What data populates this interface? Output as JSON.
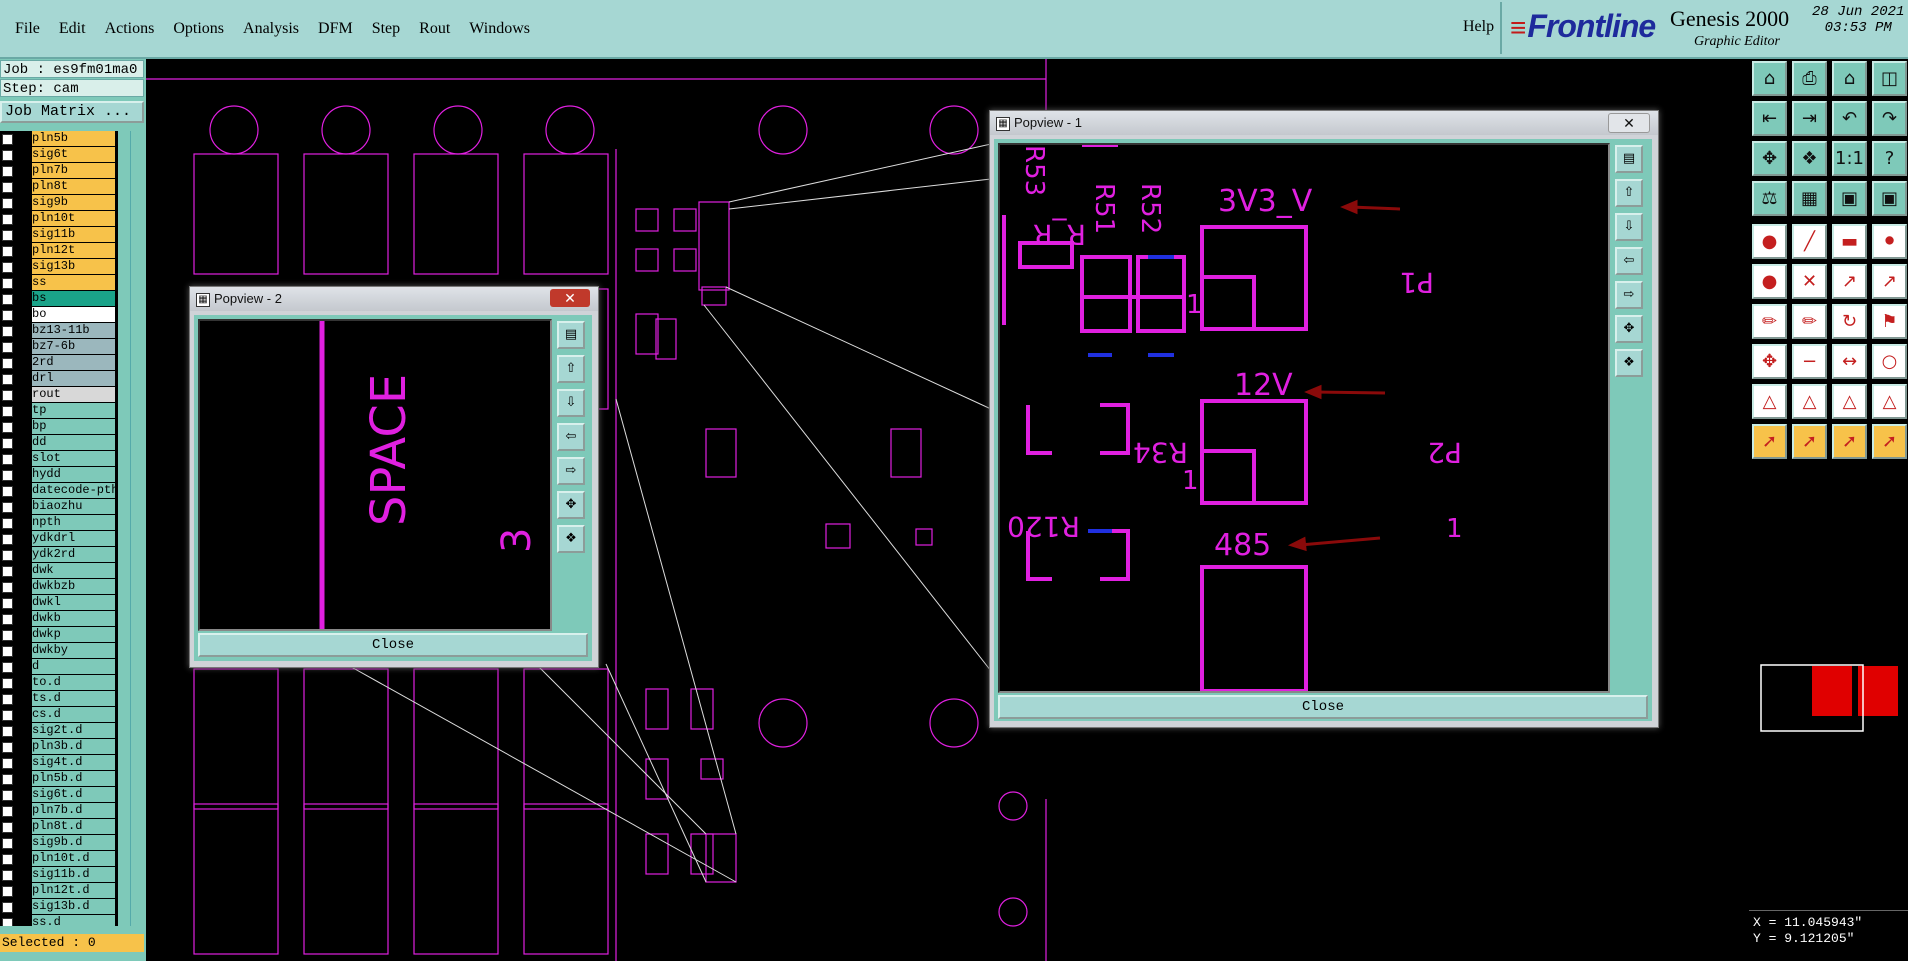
{
  "menu": {
    "items": [
      "File",
      "Edit",
      "Actions",
      "Options",
      "Analysis",
      "DFM",
      "Step",
      "Rout",
      "Windows"
    ],
    "help": "Help"
  },
  "brand": {
    "logo": "Frontline",
    "product": "Genesis 2000",
    "subtitle": "Graphic Editor",
    "date": "28 Jun 2021",
    "time": "03:53 PM"
  },
  "job": {
    "label": "Job : es9fm01ma0",
    "step": "Step: cam",
    "matrix_button": "Job Matrix ..."
  },
  "layers": [
    {
      "name": "pln5b",
      "color": "#f7c24a"
    },
    {
      "name": "sig6t",
      "color": "#f7c24a"
    },
    {
      "name": "pln7b",
      "color": "#f7c24a"
    },
    {
      "name": "pln8t",
      "color": "#f7c24a"
    },
    {
      "name": "sig9b",
      "color": "#f7c24a"
    },
    {
      "name": "pln10t",
      "color": "#f7c24a"
    },
    {
      "name": "sig11b",
      "color": "#f7c24a"
    },
    {
      "name": "pln12t",
      "color": "#f7c24a"
    },
    {
      "name": "sig13b",
      "color": "#f7c24a"
    },
    {
      "name": "ss",
      "color": "#f7c24a"
    },
    {
      "name": "bs",
      "color": "#1aa389"
    },
    {
      "name": "bo",
      "color": "#ffffff"
    },
    {
      "name": "bz13-11b",
      "color": "#9bb7bd"
    },
    {
      "name": "bz7-6b",
      "color": "#9bb7bd"
    },
    {
      "name": "2rd",
      "color": "#9bb7bd"
    },
    {
      "name": "drl",
      "color": "#9bb7bd"
    },
    {
      "name": "rout",
      "color": "#d8d8d8"
    },
    {
      "name": "tp",
      "color": "#7ec9b9"
    },
    {
      "name": "bp",
      "color": "#7ec9b9"
    },
    {
      "name": "dd",
      "color": "#7ec9b9"
    },
    {
      "name": "slot",
      "color": "#7ec9b9"
    },
    {
      "name": "hydd",
      "color": "#7ec9b9"
    },
    {
      "name": "datecode-pth",
      "color": "#7ec9b9"
    },
    {
      "name": "biaozhu",
      "color": "#7ec9b9"
    },
    {
      "name": "npth",
      "color": "#7ec9b9"
    },
    {
      "name": "ydkdrl",
      "color": "#7ec9b9"
    },
    {
      "name": "ydk2rd",
      "color": "#7ec9b9"
    },
    {
      "name": "dwk",
      "color": "#7ec9b9"
    },
    {
      "name": "dwkbzb",
      "color": "#7ec9b9"
    },
    {
      "name": "dwkl",
      "color": "#7ec9b9"
    },
    {
      "name": "dwkb",
      "color": "#7ec9b9"
    },
    {
      "name": "dwkp",
      "color": "#7ec9b9"
    },
    {
      "name": "dwkby",
      "color": "#7ec9b9"
    },
    {
      "name": "d",
      "color": "#7ec9b9"
    },
    {
      "name": "to.d",
      "color": "#7ec9b9"
    },
    {
      "name": "ts.d",
      "color": "#7ec9b9"
    },
    {
      "name": "cs.d",
      "color": "#7ec9b9"
    },
    {
      "name": "sig2t.d",
      "color": "#7ec9b9"
    },
    {
      "name": "pln3b.d",
      "color": "#7ec9b9"
    },
    {
      "name": "sig4t.d",
      "color": "#7ec9b9"
    },
    {
      "name": "pln5b.d",
      "color": "#7ec9b9"
    },
    {
      "name": "sig6t.d",
      "color": "#7ec9b9"
    },
    {
      "name": "pln7b.d",
      "color": "#7ec9b9"
    },
    {
      "name": "pln8t.d",
      "color": "#7ec9b9"
    },
    {
      "name": "sig9b.d",
      "color": "#7ec9b9"
    },
    {
      "name": "pln10t.d",
      "color": "#7ec9b9"
    },
    {
      "name": "sig11b.d",
      "color": "#7ec9b9"
    },
    {
      "name": "pln12t.d",
      "color": "#7ec9b9"
    },
    {
      "name": "sig13b.d",
      "color": "#7ec9b9"
    },
    {
      "name": "ss.d",
      "color": "#7ec9b9"
    }
  ],
  "status": {
    "selected": "Selected : 0"
  },
  "coords": {
    "x": "X = 11.045943\"",
    "y": "Y = 9.121205\""
  },
  "popview1": {
    "title": "Popview - 1",
    "close": "Close",
    "labels": {
      "v33": "3V3_V",
      "v12": "12V",
      "v485": "485",
      "p1": "P1",
      "p2": "P2",
      "r34": "R34",
      "r120": "R120",
      "r51": "R51",
      "r52": "R52",
      "r53": "R53",
      "one": "1",
      "rr": "R_R"
    }
  },
  "popview2": {
    "title": "Popview - 2",
    "close": "Close",
    "text": "SPACE",
    "digit": "3"
  },
  "colors": {
    "panel": "#a6d7d3",
    "board": "#e020e0",
    "accent": "#7ec9b9",
    "highlight": "#f7c24a"
  }
}
